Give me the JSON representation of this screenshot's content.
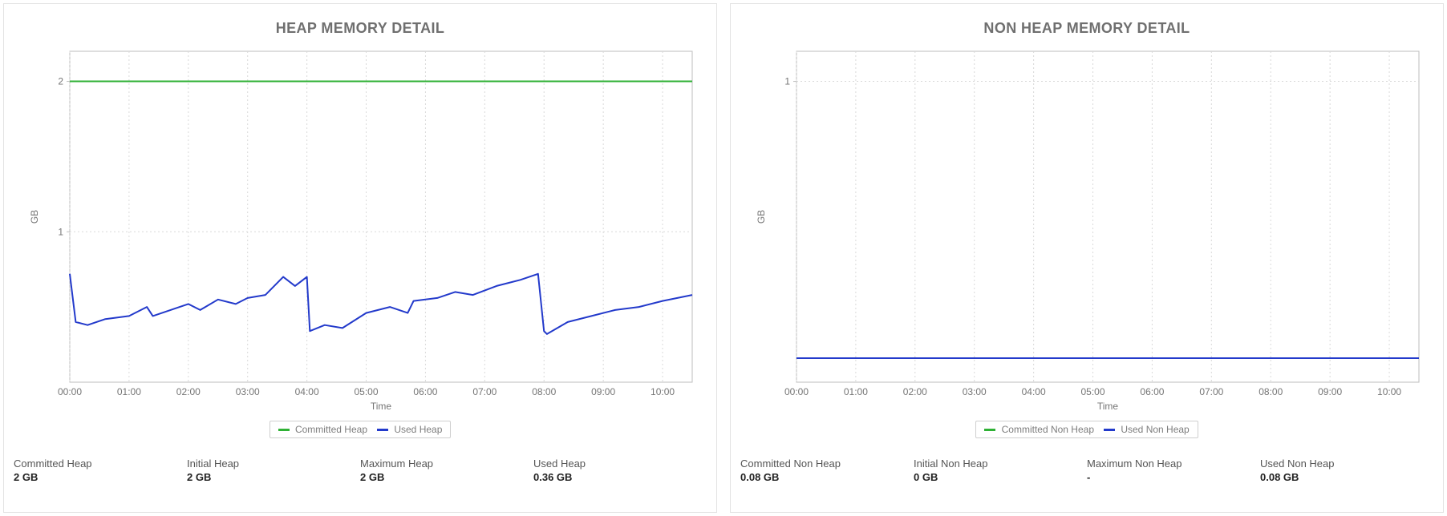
{
  "panels": [
    {
      "title": "HEAP MEMORY DETAIL",
      "legend": [
        {
          "label": "Committed Heap",
          "color": "#2fb135"
        },
        {
          "label": "Used Heap",
          "color": "#233acb"
        }
      ],
      "stats": [
        {
          "label": "Committed Heap",
          "value": "2 GB"
        },
        {
          "label": "Initial Heap",
          "value": "2 GB"
        },
        {
          "label": "Maximum Heap",
          "value": "2 GB"
        },
        {
          "label": "Used Heap",
          "value": "0.36 GB"
        }
      ]
    },
    {
      "title": "NON HEAP MEMORY DETAIL",
      "legend": [
        {
          "label": "Committed Non Heap",
          "color": "#2fb135"
        },
        {
          "label": "Used Non Heap",
          "color": "#233acb"
        }
      ],
      "stats": [
        {
          "label": "Committed Non Heap",
          "value": "0.08 GB"
        },
        {
          "label": "Initial Non Heap",
          "value": "0 GB"
        },
        {
          "label": "Maximum Non Heap",
          "value": "-"
        },
        {
          "label": "Used Non Heap",
          "value": "0.08 GB"
        }
      ]
    }
  ],
  "axis": {
    "xlabel": "Time",
    "ylabel": "GB"
  },
  "chart_data": [
    {
      "type": "line",
      "title": "HEAP MEMORY DETAIL",
      "xlabel": "Time",
      "ylabel": "GB",
      "ylim": [
        0,
        2.2
      ],
      "xticks": [
        "00:00",
        "01:00",
        "02:00",
        "03:00",
        "04:00",
        "05:00",
        "06:00",
        "07:00",
        "08:00",
        "09:00",
        "10:00"
      ],
      "x": [
        0,
        0.1,
        0.3,
        0.6,
        1.0,
        1.3,
        1.4,
        1.7,
        2.0,
        2.2,
        2.5,
        2.8,
        3.0,
        3.3,
        3.6,
        3.8,
        4.0,
        4.05,
        4.3,
        4.6,
        5.0,
        5.4,
        5.7,
        5.8,
        6.2,
        6.5,
        6.8,
        7.2,
        7.6,
        7.9,
        8.0,
        8.05,
        8.4,
        8.8,
        9.2,
        9.6,
        10.0,
        10.5
      ],
      "series": [
        {
          "name": "Committed Heap",
          "color": "#2fb135",
          "values": [
            2.0,
            2.0,
            2.0,
            2.0,
            2.0,
            2.0,
            2.0,
            2.0,
            2.0,
            2.0,
            2.0,
            2.0,
            2.0,
            2.0,
            2.0,
            2.0,
            2.0,
            2.0,
            2.0,
            2.0,
            2.0,
            2.0,
            2.0,
            2.0,
            2.0,
            2.0,
            2.0,
            2.0,
            2.0,
            2.0,
            2.0,
            2.0,
            2.0,
            2.0,
            2.0,
            2.0,
            2.0,
            2.0
          ]
        },
        {
          "name": "Used Heap",
          "color": "#233acb",
          "values": [
            0.72,
            0.4,
            0.38,
            0.42,
            0.44,
            0.5,
            0.44,
            0.48,
            0.52,
            0.48,
            0.55,
            0.52,
            0.56,
            0.58,
            0.7,
            0.64,
            0.7,
            0.34,
            0.38,
            0.36,
            0.46,
            0.5,
            0.46,
            0.54,
            0.56,
            0.6,
            0.58,
            0.64,
            0.68,
            0.72,
            0.34,
            0.32,
            0.4,
            0.44,
            0.48,
            0.5,
            0.54,
            0.58
          ]
        }
      ]
    },
    {
      "type": "line",
      "title": "NON HEAP MEMORY DETAIL",
      "xlabel": "Time",
      "ylabel": "GB",
      "ylim": [
        0,
        1.1
      ],
      "xticks": [
        "00:00",
        "01:00",
        "02:00",
        "03:00",
        "04:00",
        "05:00",
        "06:00",
        "07:00",
        "08:00",
        "09:00",
        "10:00"
      ],
      "x": [
        0,
        1,
        2,
        3,
        4,
        5,
        6,
        7,
        8,
        9,
        10,
        10.5
      ],
      "series": [
        {
          "name": "Committed Non Heap",
          "color": "#2fb135",
          "values": [
            0.08,
            0.08,
            0.08,
            0.08,
            0.08,
            0.08,
            0.08,
            0.08,
            0.08,
            0.08,
            0.08,
            0.08
          ]
        },
        {
          "name": "Used Non Heap",
          "color": "#233acb",
          "values": [
            0.08,
            0.08,
            0.08,
            0.08,
            0.08,
            0.08,
            0.08,
            0.08,
            0.08,
            0.08,
            0.08,
            0.08
          ]
        }
      ]
    }
  ]
}
